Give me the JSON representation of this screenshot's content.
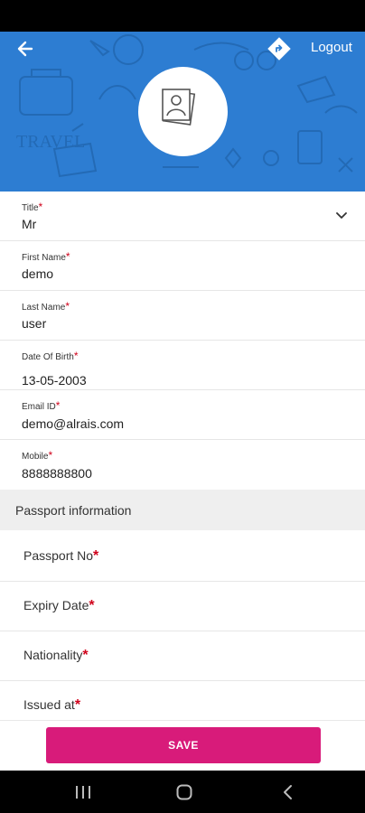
{
  "header": {
    "logout_label": "Logout",
    "doodle_text": "TRAVEL",
    "brand_color": "#2d7dd2"
  },
  "profile": {
    "fields": [
      {
        "label": "Title",
        "value": "Mr"
      },
      {
        "label": "First Name",
        "value": "demo"
      },
      {
        "label": "Last Name",
        "value": "user"
      },
      {
        "label": "Date Of Birth",
        "value": "13-05-2003"
      },
      {
        "label": "Email ID",
        "value": "demo@alrais.com"
      },
      {
        "label": "Mobile",
        "value": "8888888800"
      }
    ],
    "required_mark": "*"
  },
  "passport": {
    "section_title": "Passport information",
    "fields": [
      {
        "label": "Passport No"
      },
      {
        "label": "Expiry Date"
      },
      {
        "label": "Nationality"
      },
      {
        "label": "Issued at"
      }
    ]
  },
  "actions": {
    "save_label": "SAVE",
    "save_color": "#d81b7a"
  },
  "icons": {
    "back": "arrow-left-icon",
    "directions": "directions-diamond-icon",
    "avatar": "profile-photo-icon",
    "dropdown": "chevron-down-icon",
    "nav_recent": "recent-apps-icon",
    "nav_home": "home-icon",
    "nav_back": "nav-back-icon"
  }
}
